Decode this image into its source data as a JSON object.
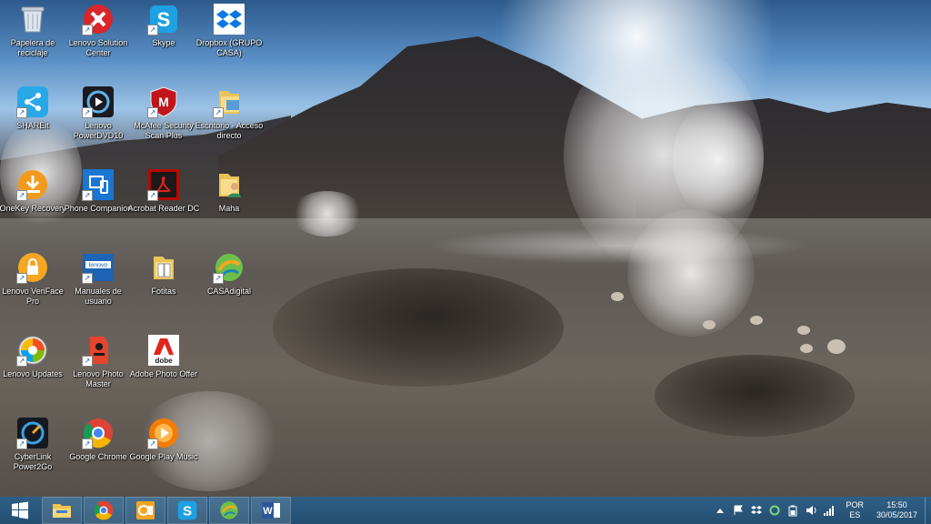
{
  "desktop": {
    "icons": [
      {
        "label": "Papelera de reciclaje",
        "icon": "recycle-bin-icon"
      },
      {
        "label": "Lenovo Solution Center",
        "icon": "lenovo-solution-center-icon"
      },
      {
        "label": "Skype",
        "icon": "skype-icon"
      },
      {
        "label": "Dropbox (GRUPO CASA)",
        "icon": "dropbox-icon"
      },
      {
        "label": "SHAREit",
        "icon": "shareit-icon"
      },
      {
        "label": "Lenovo PowerDVD10",
        "icon": "powerdvd-icon"
      },
      {
        "label": "McAfee Security Scan Plus",
        "icon": "mcafee-icon"
      },
      {
        "label": "Escritorio - Acceso directo",
        "icon": "folder-icon"
      },
      {
        "label": "OneKey Recovery",
        "icon": "onekey-recovery-icon"
      },
      {
        "label": "Phone Companion",
        "icon": "phone-companion-icon"
      },
      {
        "label": "Acrobat Reader DC",
        "icon": "acrobat-icon"
      },
      {
        "label": "Maha",
        "icon": "user-folder-icon"
      },
      {
        "label": "Lenovo VeriFace Pro",
        "icon": "veriface-icon"
      },
      {
        "label": "Manuales de usuario",
        "icon": "manual-icon"
      },
      {
        "label": "Fotitas",
        "icon": "folder-icon"
      },
      {
        "label": "CASAdigital",
        "icon": "casadigital-icon"
      },
      {
        "label": "Lenovo Updates",
        "icon": "lenovo-updates-icon"
      },
      {
        "label": "Lenovo Photo Master",
        "icon": "photo-master-icon"
      },
      {
        "label": "Adobe Photo Offer",
        "icon": "adobe-icon"
      },
      {
        "label": "CyberLink Power2Go",
        "icon": "power2go-icon"
      },
      {
        "label": "Google Chrome",
        "icon": "chrome-icon"
      },
      {
        "label": "Google Play Music",
        "icon": "play-music-icon"
      }
    ]
  },
  "taskbar": {
    "apps": [
      "file-explorer-icon",
      "chrome-icon",
      "outlook-icon",
      "skype-icon",
      "casadigital-icon",
      "word-icon"
    ],
    "language": {
      "line1": "POR",
      "line2": "ES"
    },
    "clock": {
      "time": "15:50",
      "date": "30/05/2017"
    }
  },
  "colors": {
    "taskbar": "#2a587c",
    "start": "#ffffff"
  }
}
